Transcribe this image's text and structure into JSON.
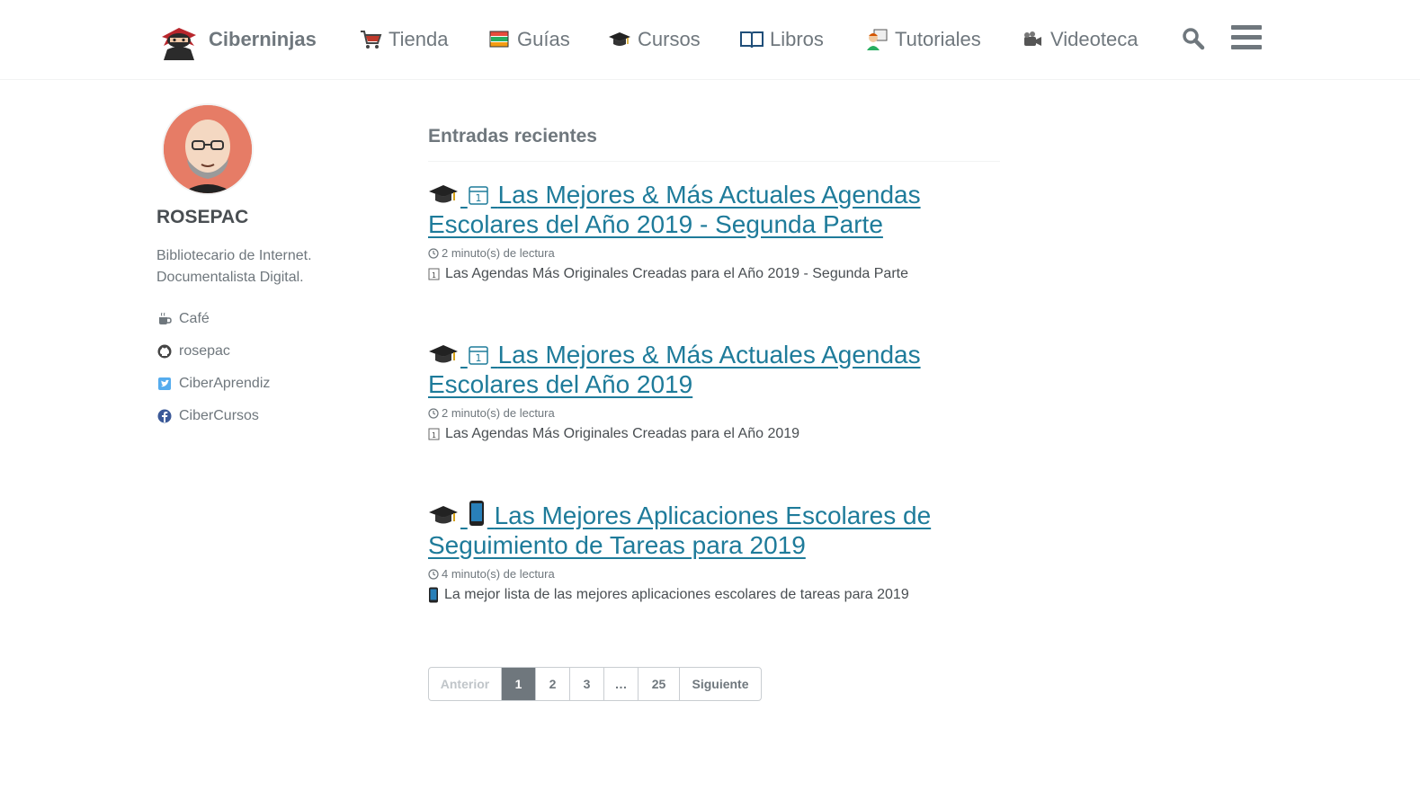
{
  "header": {
    "site_title": "Ciberninjas",
    "nav": [
      {
        "label": "Tienda",
        "icon": "shopping-cart-icon"
      },
      {
        "label": "Guías",
        "icon": "books-icon"
      },
      {
        "label": "Cursos",
        "icon": "graduation-cap-icon"
      },
      {
        "label": "Libros",
        "icon": "open-book-icon"
      },
      {
        "label": "Tutoriales",
        "icon": "teacher-icon"
      },
      {
        "label": "Videoteca",
        "icon": "camera-icon"
      }
    ],
    "search_icon": "search-icon",
    "menu_icon": "hamburger-menu-icon"
  },
  "sidebar": {
    "author_name": "ROSEPAC",
    "bio_lines": [
      "Bibliotecario de Internet.",
      "Documentalista Digital."
    ],
    "links": [
      {
        "label": "Café",
        "icon": "coffee-icon"
      },
      {
        "label": "rosepac",
        "icon": "github-icon"
      },
      {
        "label": "CiberAprendiz",
        "icon": "twitter-icon"
      },
      {
        "label": "CiberCursos",
        "icon": "facebook-icon"
      }
    ]
  },
  "main": {
    "section_title": "Entradas recientes",
    "posts": [
      {
        "title": "Las Mejores & Más Actuales Agendas Escolares del Año 2019 - Segunda Parte",
        "read_time": "2 minuto(s) de lectura",
        "excerpt": "Las Agendas Más Originales Creadas para el Año 2019 - Segunda Parte",
        "icons": [
          "graduation-cap-icon",
          "calendar-icon"
        ]
      },
      {
        "title": "Las Mejores & Más Actuales Agendas Escolares del Año 2019",
        "read_time": "2 minuto(s) de lectura",
        "excerpt": "Las Agendas Más Originales Creadas para el Año 2019",
        "icons": [
          "graduation-cap-icon",
          "calendar-icon"
        ]
      },
      {
        "title": "Las Mejores Aplicaciones Escolares de Seguimiento de Tareas para 2019",
        "read_time": "4 minuto(s) de lectura",
        "excerpt": "La mejor lista de las mejores aplicaciones escolares de tareas para 2019",
        "icons": [
          "graduation-cap-icon",
          "mobile-phone-icon"
        ]
      }
    ]
  },
  "pagination": {
    "previous": "Anterior",
    "pages": [
      "1",
      "2",
      "3",
      "…",
      "25"
    ],
    "current": "1",
    "next": "Siguiente"
  },
  "colors": {
    "link": "#1e7b9a",
    "text": "#494e52",
    "muted": "#6f777d",
    "avatar_bg": "#e67c66"
  }
}
